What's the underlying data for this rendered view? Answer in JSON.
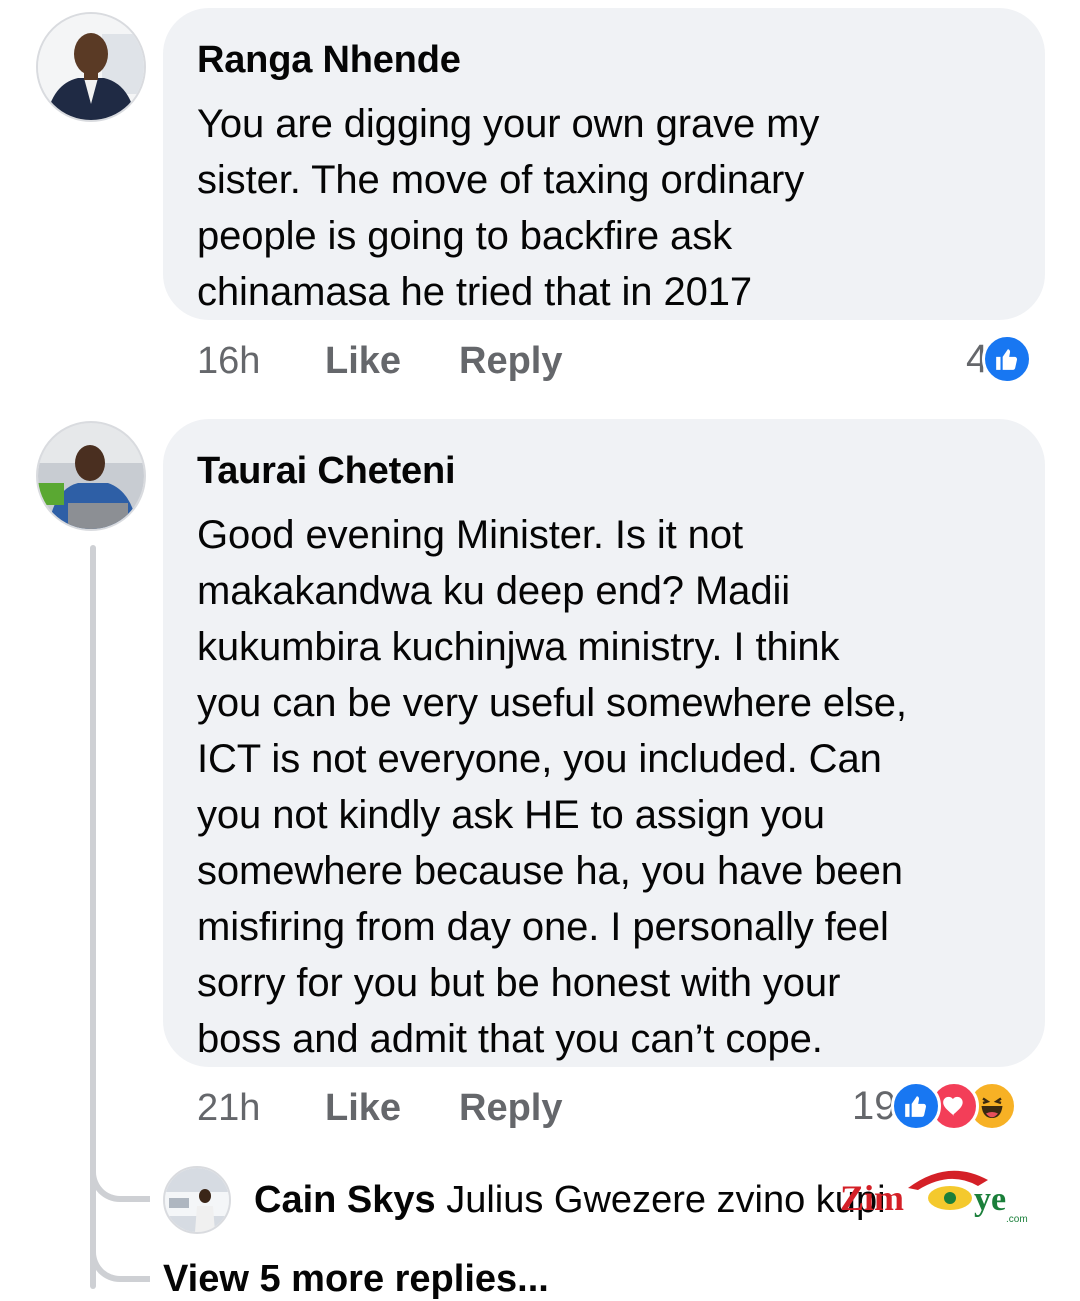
{
  "comments": [
    {
      "author": "Ranga Nhende",
      "lines": [
        "You are digging your own grave my",
        "sister. The move of taxing ordinary",
        "people is going to backfire ask",
        "chinamasa he tried that in 2017"
      ],
      "time": "16h",
      "like_label": "Like",
      "reply_label": "Reply",
      "reaction_count": "4",
      "reactions": [
        "like-icon"
      ]
    },
    {
      "author": "Taurai Cheteni",
      "lines": [
        "Good evening Minister. Is it not",
        "makakandwa ku deep end? Madii",
        "kukumbira kuchinjwa ministry. I think",
        "you can be very useful somewhere else,",
        "ICT is not everyone, you included. Can",
        "you not kindly ask HE to assign you",
        "somewhere because ha, you have been",
        "misfiring from day one. I personally feel",
        "sorry for you but be honest with your",
        "boss and admit that you can’t cope."
      ],
      "time": "21h",
      "like_label": "Like",
      "reply_label": "Reply",
      "reaction_count": "19",
      "reactions": [
        "like-icon",
        "love-icon",
        "haha-icon"
      ]
    }
  ],
  "reply_preview": {
    "author": "Cain Skys",
    "text": "Julius Gwezere zvino kupi"
  },
  "view_more_label": "View 5 more replies...",
  "watermark": {
    "text": "ZimEye",
    "suffix": ".com"
  },
  "colors": {
    "bubble": "#f0f2f5",
    "meta_text": "#65676b",
    "like_blue": "#1877f2",
    "love_red": "#f33e58",
    "haha_yellow": "#f7b125"
  }
}
